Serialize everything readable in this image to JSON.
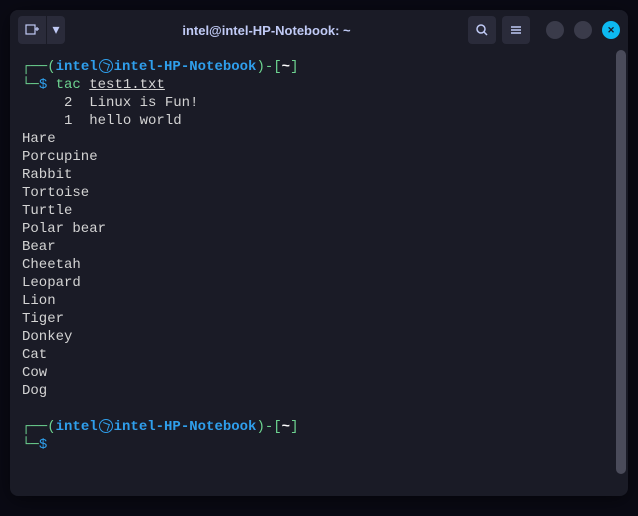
{
  "titlebar": {
    "title": "intel@intel-HP-Notebook: ~"
  },
  "prompt1": {
    "user": "intel",
    "host": "intel-HP-Notebook",
    "path": "~",
    "command": "tac",
    "arg": "test1.txt"
  },
  "output": {
    "line1": "     2\tLinux is Fun!",
    "line2": "     1\thello world",
    "animals": [
      "Hare",
      "Porcupine",
      "Rabbit",
      "Tortoise",
      "Turtle",
      "Polar bear",
      "Bear",
      "Cheetah",
      "Leopard",
      "Lion",
      "Tiger",
      "Donkey",
      "Cat",
      "Cow",
      "Dog"
    ]
  },
  "prompt2": {
    "user": "intel",
    "host": "intel-HP-Notebook",
    "path": "~"
  }
}
